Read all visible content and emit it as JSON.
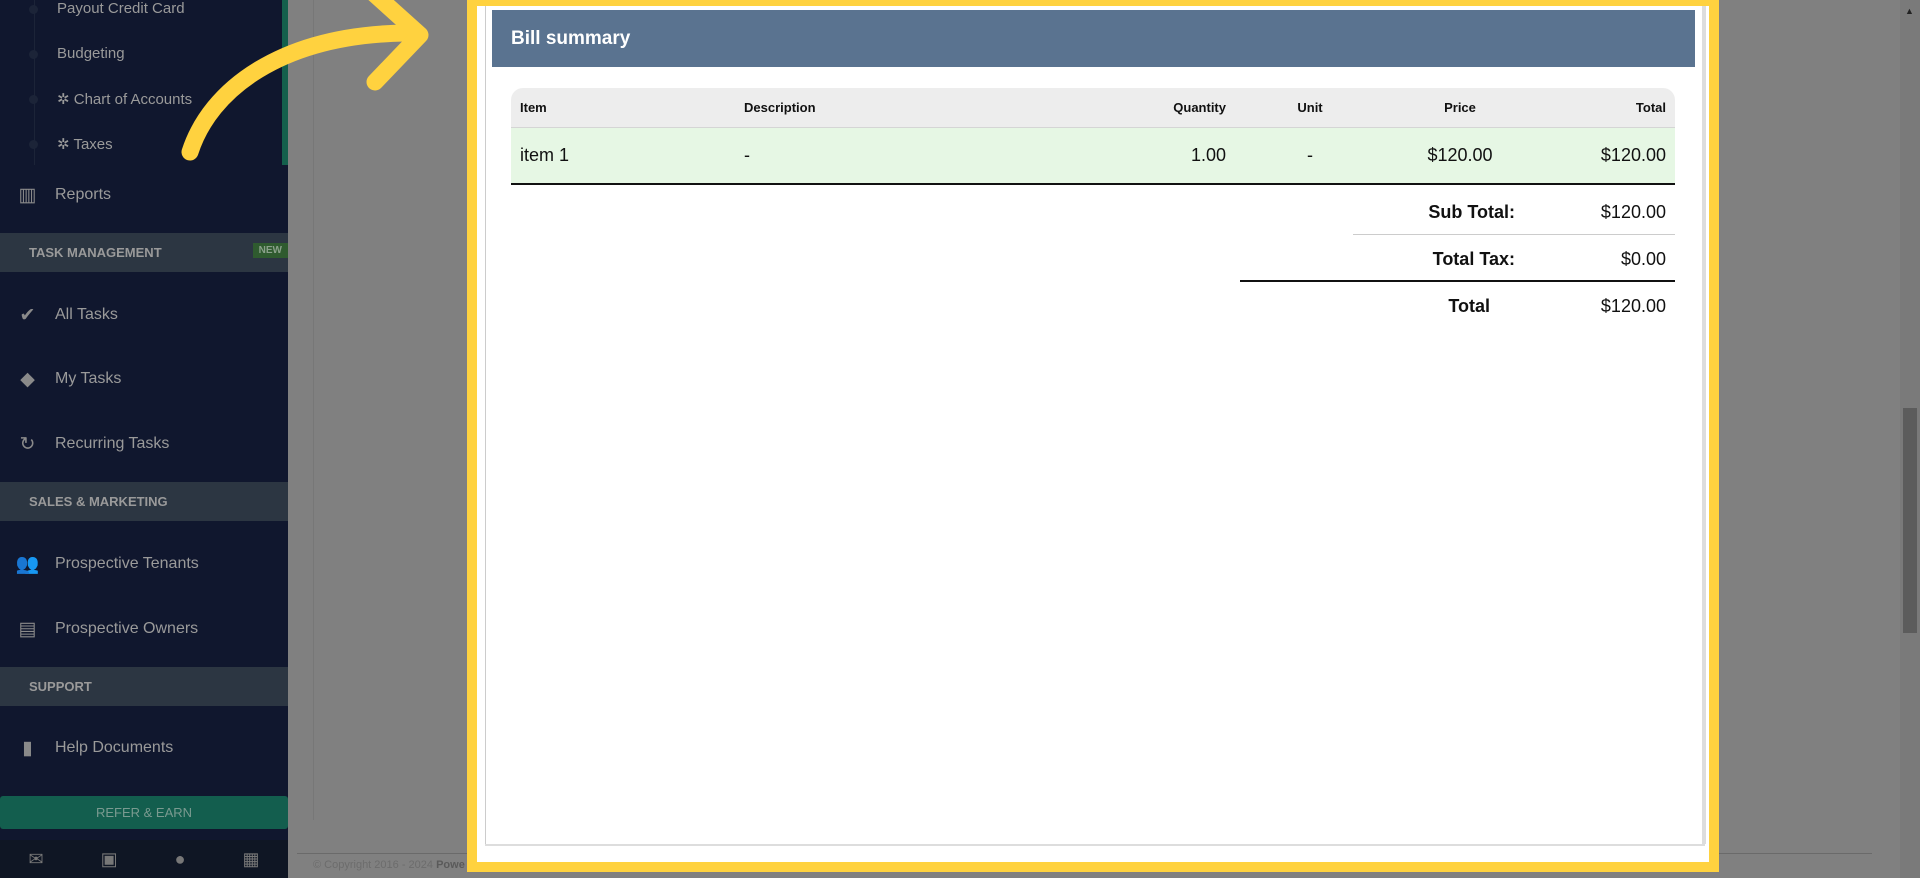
{
  "sidebar": {
    "sub_items": [
      "Payout Credit Card",
      "Budgeting",
      "Chart of Accounts",
      "Taxes"
    ],
    "reports": "Reports",
    "task_header": "TASK MANAGEMENT",
    "new_badge": "NEW",
    "tasks": [
      "All Tasks",
      "My Tasks",
      "Recurring Tasks"
    ],
    "sales_header": "SALES & MARKETING",
    "sales": [
      "Prospective Tenants",
      "Prospective Owners"
    ],
    "support_header": "SUPPORT",
    "support": [
      "Help Documents"
    ],
    "refer": "REFER & EARN"
  },
  "footer": {
    "copyright": "© Copyright 2016 - 2024",
    "brand": "Powe"
  },
  "bill": {
    "title": "Bill summary",
    "columns": [
      "Item",
      "Description",
      "Quantity",
      "Unit",
      "Price",
      "Total"
    ],
    "rows": [
      {
        "item": "item 1",
        "description": "-",
        "quantity": "1.00",
        "unit": "-",
        "price": "$120.00",
        "total": "$120.00"
      }
    ],
    "subtotal_label": "Sub Total:",
    "subtotal": "$120.00",
    "tax_label": "Total Tax:",
    "tax": "$0.00",
    "total_label": "Total",
    "total": "$120.00"
  },
  "colors": {
    "highlight": "#ffd23f",
    "header": "#5a7390",
    "row": "#e6f7e4"
  }
}
